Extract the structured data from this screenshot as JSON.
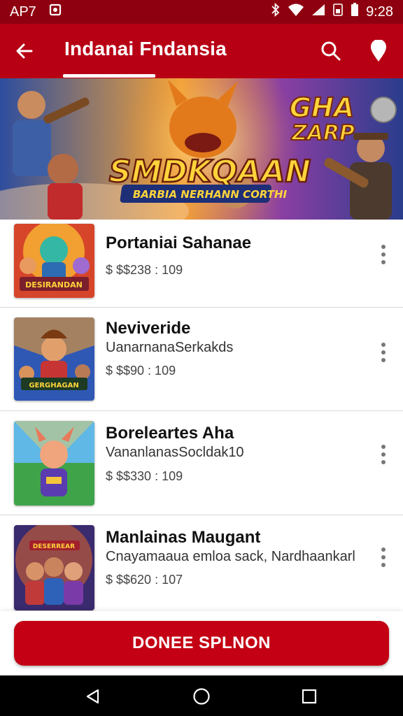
{
  "status_bar": {
    "carrier": "AP7",
    "time": "9:28",
    "icons": [
      "notification-icon",
      "bluetooth-icon",
      "wifi-icon",
      "signal-icon",
      "sim-icon",
      "battery-icon"
    ]
  },
  "app_bar": {
    "title": "Indanai Fndansia",
    "back_icon": "back-arrow-icon",
    "search_icon": "search-icon",
    "pin_icon": "location-pin-icon"
  },
  "banner": {
    "headline": "SMDKQAAN",
    "subline": "BARBIA NERHANN CORTHI",
    "corner_text_line1": "GHA",
    "corner_text_line2": "ZARP"
  },
  "list": {
    "items": [
      {
        "title": "Portaniai Sahanae",
        "subtitle": "",
        "meta": "$ $$238 : 109",
        "thumb_caption": "DESIRANDAN"
      },
      {
        "title": "Neviveride",
        "subtitle": "UanarnanaSerkakds",
        "meta": "$ $$90 : 109",
        "thumb_caption": "GERGHAGAN"
      },
      {
        "title": "Boreleartes Aha",
        "subtitle": "VananlanasSocldak10",
        "meta": "$ $$330 : 109",
        "thumb_caption": ""
      },
      {
        "title": "Manlainas Maugant",
        "subtitle": "Cnayamaaua emloa sack, Nardhaankarl",
        "meta": "$ $$620 : 107",
        "thumb_caption": "DESERREAR"
      }
    ]
  },
  "cta": {
    "label": "DONEE SPLNON"
  },
  "nav": {
    "back": "nav-back-icon",
    "home": "nav-home-icon",
    "recents": "nav-recents-icon"
  },
  "colors": {
    "primary": "#b80015",
    "status_bar": "#8e0010",
    "cta": "#c40014"
  }
}
